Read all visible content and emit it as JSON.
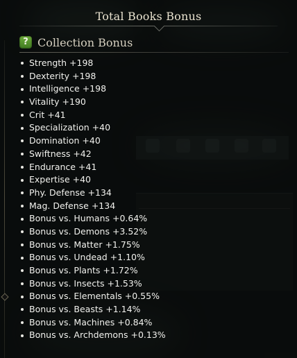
{
  "window": {
    "title": "Total Books Bonus"
  },
  "section": {
    "icon": "question-help-icon",
    "icon_glyph": "?",
    "title": "Collection Bonus"
  },
  "bonuses": [
    {
      "label": "Strength +198"
    },
    {
      "label": "Dexterity +198"
    },
    {
      "label": "Intelligence +198"
    },
    {
      "label": "Vitality +190"
    },
    {
      "label": "Crit +41"
    },
    {
      "label": "Specialization +40"
    },
    {
      "label": "Domination +40"
    },
    {
      "label": "Swiftness +42"
    },
    {
      "label": "Endurance +41"
    },
    {
      "label": "Expertise +40"
    },
    {
      "label": "Phy. Defense +134"
    },
    {
      "label": "Mag. Defense +134"
    },
    {
      "label": "Bonus vs. Humans +0.64%"
    },
    {
      "label": "Bonus vs. Demons +3.52%"
    },
    {
      "label": "Bonus vs. Matter +1.75%"
    },
    {
      "label": "Bonus vs. Undead +1.10%"
    },
    {
      "label": "Bonus vs. Plants +1.72%"
    },
    {
      "label": "Bonus vs. Insects +1.53%"
    },
    {
      "label": "Bonus vs. Elementals +0.55%"
    },
    {
      "label": "Bonus vs. Beasts +1.14%"
    },
    {
      "label": "Bonus vs. Machines +0.84%"
    },
    {
      "label": "Bonus vs. Archdemons +0.13%"
    }
  ],
  "colors": {
    "text": "#f2f2ee",
    "title": "#e9e2cf",
    "help_icon": "#5c9a31"
  }
}
